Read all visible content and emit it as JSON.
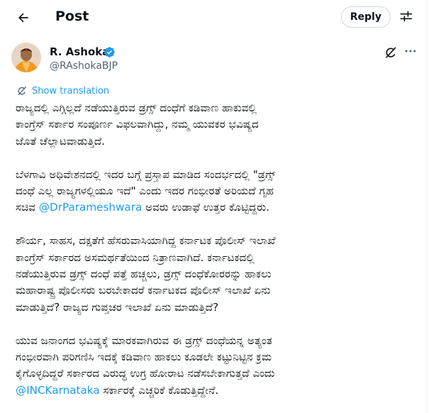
{
  "header": {
    "title": "Post",
    "reply_label": "Reply"
  },
  "author": {
    "name": "R. Ashoka",
    "handle": "@RAshokaBJP"
  },
  "show_translation": "Show translation",
  "tweet": {
    "p1": [
      "ರಾಜ್ಯದಲ್ಲಿ ಎಗ್ಗಿಲ್ಲದೆ ನಡೆಯುತ್ತಿರುವ ಡ್ರಗ್ಸ್ ದಂಧೆಗೆ ಕಡಿವಾಣ ಹಾಕುವಲ್ಲಿ",
      "ಕಾಂಗ್ರೆಸ್ ಸರ್ಕಾರ ಸಂಪೂರ್ಣ ವಿಫಲವಾಗಿದ್ದು, ನಮ್ಮ ಯುವಕರ ಭವಿಷ್ಯದ",
      "ಜೊತೆ ಚೆಲ್ಲಾಟವಾಡುತ್ತಿದೆ."
    ],
    "p2": [
      "ಬೆಳಗಾವಿ ಅಧಿವೇಶನದಲ್ಲಿ ಇದರ ಬಗ್ಗೆ ಪ್ರಸ್ತಾಪ ಮಾಡಿದ ಸಂದರ್ಭದಲ್ಲಿ \"ಡ್ರಗ್ಸ್",
      "ದಂಧೆ ಎಲ್ಲ ರಾಜ್ಯಗಳಲ್ಲಿಯೂ ಇದೆ\" ಎಂದು ಇದರ ಗಂಭೀರತೆ ಅರಿಯದೆ ಗೃಹ"
    ],
    "p2_l3_pre": "ಸಚಿವ ",
    "p2_mention": "@DrParameshwara",
    "p2_l3_post": " ಅವರು ಉಡಾಫೆ ಉತ್ತರ ಕೊಟ್ಟಿದ್ದರು.",
    "p3": [
      "ಶೌರ್ಯ, ಸಾಹಸ, ದಕ್ಷತೆಗೆ ಹೆಸರುವಾಸಿಯಾಗಿದ್ದ ಕರ್ನಾಟಕ ಪೊಲೀಸ್ ಇಲಾಖೆ",
      "ಕಾಂಗ್ರೆಸ್ ಸರ್ಕಾರದ ಅಸಮರ್ಥತೆಯಿಂದ ನಿತ್ರಾಣವಾಗಿದೆ.  ಕರ್ನಾಟಕದಲ್ಲಿ",
      "ನಡೆಯುತ್ತಿರುವ ಡ್ರಗ್ಸ್ ದಂಧೆ ಪತ್ತೆ ಹಚ್ಚಲು, ಡ್ರಗ್ಸ್ ದಂಧೆಕೋರರನ್ನು ಹಾಕಲು",
      "ಮಹಾರಾಷ್ಟ್ರ ಪೊಲೀಸರು ಬರಬೇಕಾದರೆ ಕರ್ನಾಟಕದ ಪೊಲೀಸ್ ಇಲಾಖೆ ಏನು",
      "ಮಾಡುತ್ತಿದೆ? ರಾಜ್ಯದ ಗುಪ್ತಚರ ಇಲಾಖೆ ಏನು ಮಾಡುತ್ತಿದೆ?"
    ],
    "p4": [
      "ಯುವ ಜನಾಂಗದ ಭವಿಷ್ಯಕ್ಕೆ ಮಾರಕವಾಗಿರುವ ಈ ಡ್ರಗ್ಸ್ ದಂಧೆಯನ್ನ ಅತ್ಯಂತ",
      "ಗಂಭೀರವಾಗಿ ಪರಿಗಣಿಸಿ ಇದಕ್ಕೆ ಕಡಿವಾಣ ಹಾಕಲು ಕೂಡಲೇ ಕಟ್ಟುನಿಟ್ಟಿನ ಕ್ರಮ",
      "ಕೈಗೊಳ್ಳದಿದ್ದರೆ ಸರ್ಕಾರದ ವಿರುದ್ಧ ಉಗ್ರ ಹೋರಾಟ ನಡೆಸಬೇಕಾಗುತ್ತದೆ ಎಂದು"
    ],
    "p4_mention": "@INCKarnataka",
    "p4_l4_post": " ಸರ್ಕಾರಕ್ಕೆ ಎಚ್ಚರಿಕೆ ಕೊಡುತ್ತಿದ್ದೇನೆ."
  },
  "icons": {
    "back": "arrow-left-icon",
    "settings": "sliders-icon",
    "verified": "verified-badge-icon",
    "grok": "grok-icon",
    "more": "more-horizontal-icon",
    "translate": "translate-icon"
  },
  "colors": {
    "accent": "#1d9bf0",
    "text": "#0f1419",
    "secondary": "#536471",
    "border": "#cfd9de"
  }
}
